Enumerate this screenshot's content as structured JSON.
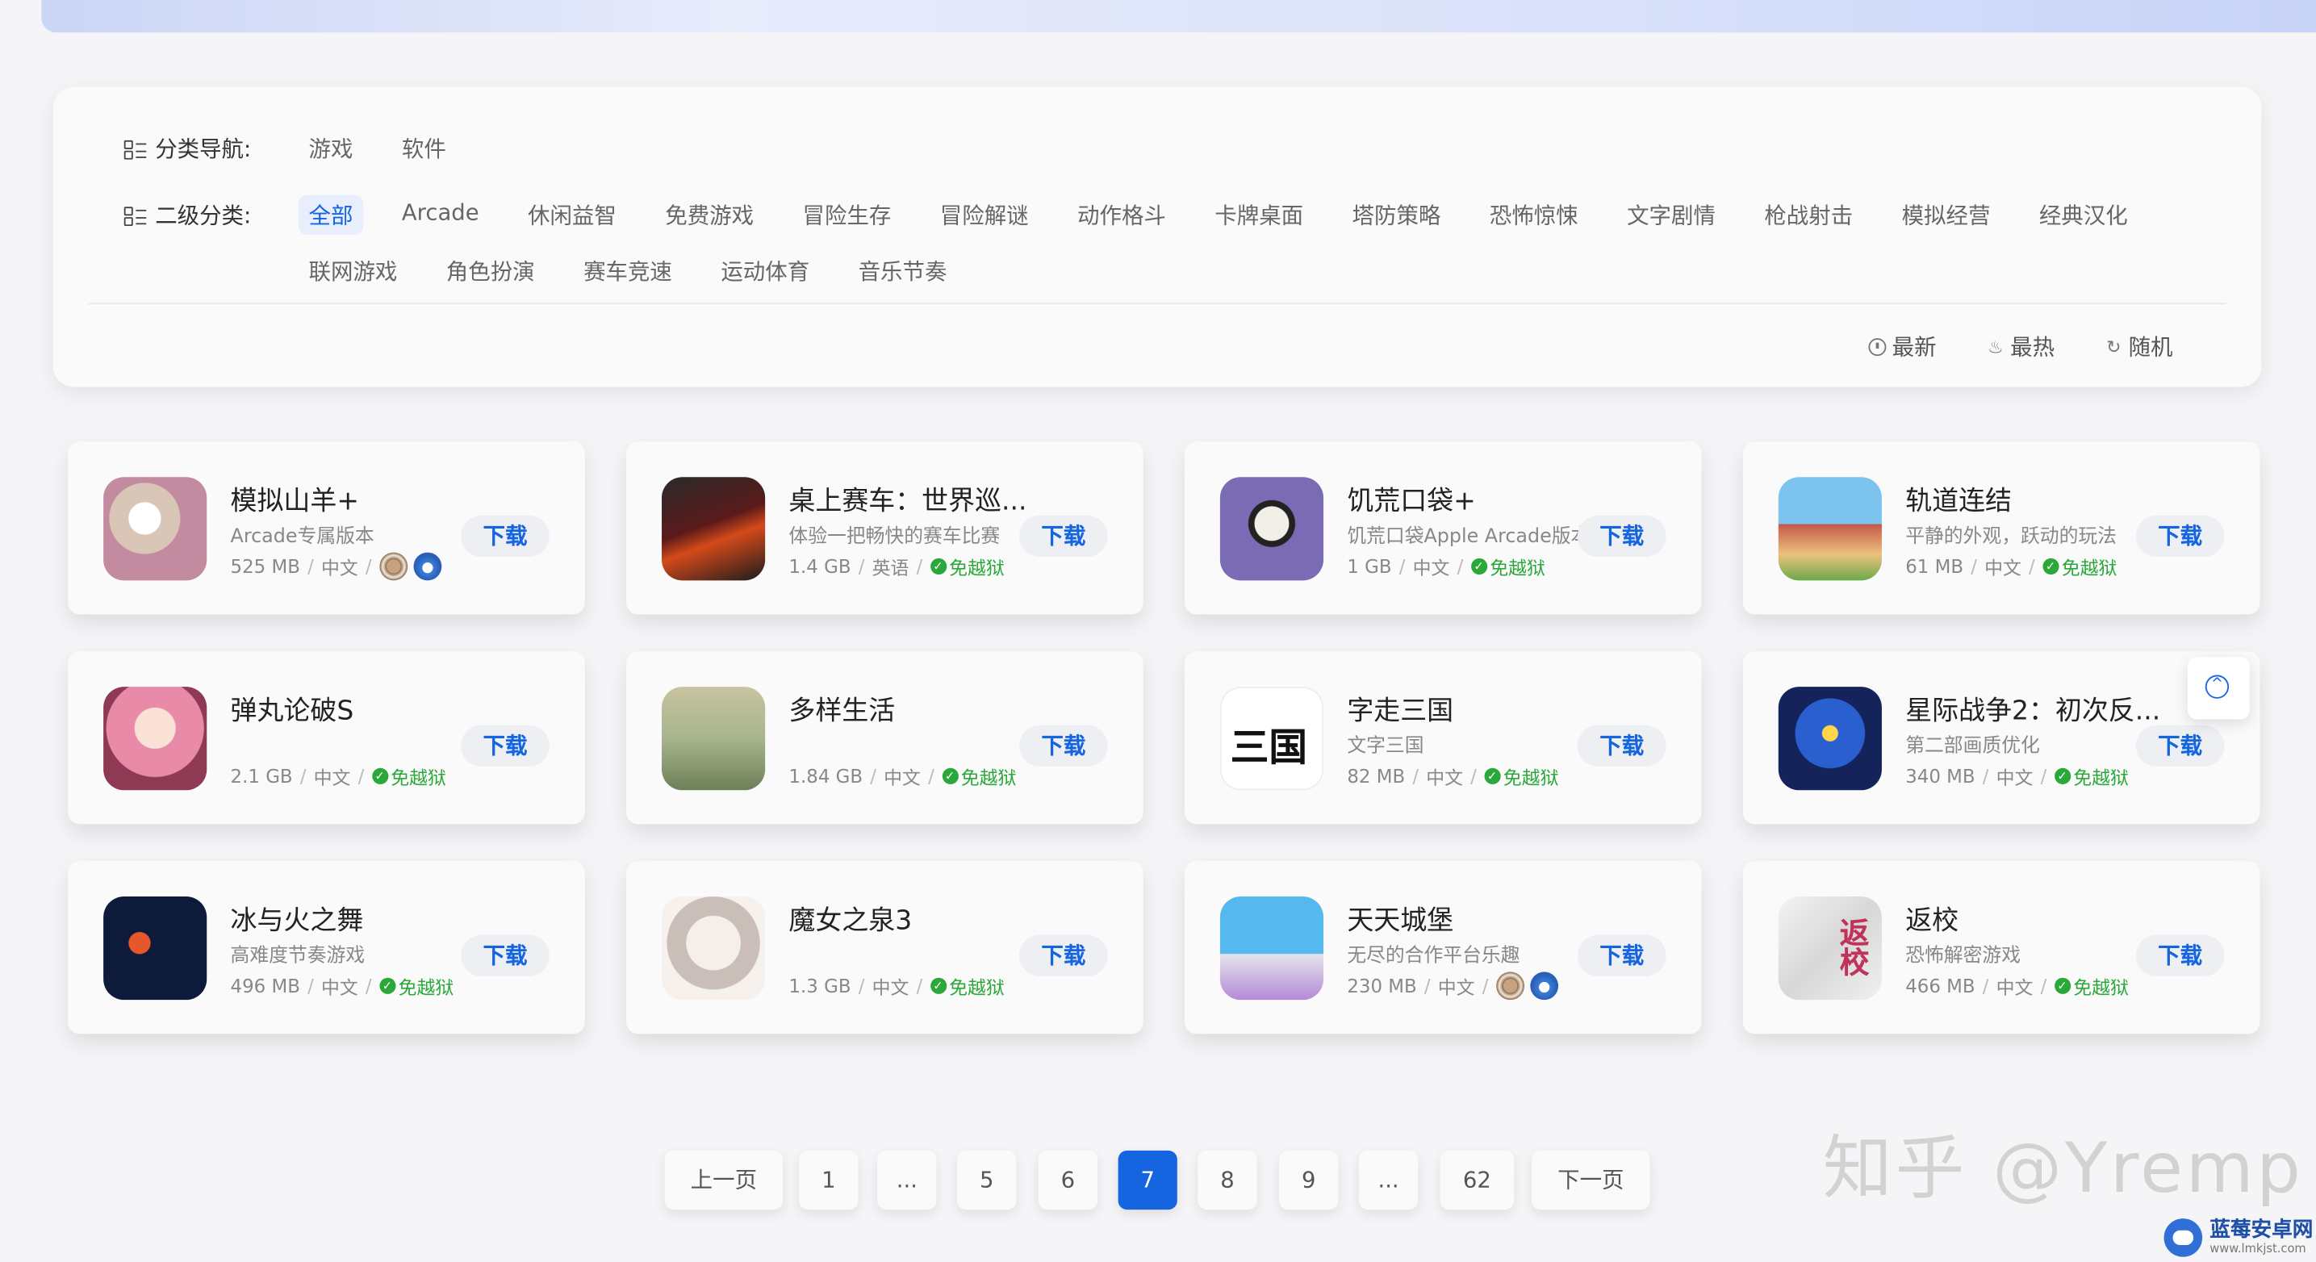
{
  "filters": {
    "category_label": "分类导航:",
    "categories": [
      "游戏",
      "软件"
    ],
    "subcategory_label": "二级分类:",
    "subcategories": [
      "全部",
      "Arcade",
      "休闲益智",
      "免费游戏",
      "冒险生存",
      "冒险解谜",
      "动作格斗",
      "卡牌桌面",
      "塔防策略",
      "恐怖惊悚",
      "文字剧情",
      "枪战射击",
      "模拟经营",
      "经典汉化",
      "联网游戏",
      "角色扮演",
      "赛车竞速",
      "运动体育",
      "音乐节奏"
    ],
    "active_subcategory": "全部",
    "sort": {
      "newest": "最新",
      "hottest": "最热",
      "random": "随机"
    }
  },
  "apps": [
    {
      "name": "模拟山羊+",
      "desc": "Arcade专属版本",
      "size": "525 MB",
      "lang": "中文",
      "jailbreak": "",
      "badges": true
    },
    {
      "name": "桌上赛车：世界巡...",
      "desc": "体验一把畅快的赛车比赛",
      "size": "1.4 GB",
      "lang": "英语",
      "jailbreak": "免越狱",
      "badges": false
    },
    {
      "name": "饥荒口袋+",
      "desc": "饥荒口袋Apple Arcade版本",
      "size": "1 GB",
      "lang": "中文",
      "jailbreak": "免越狱",
      "badges": false
    },
    {
      "name": "轨道连结",
      "desc": "平静的外观，跃动的玩法",
      "size": "61 MB",
      "lang": "中文",
      "jailbreak": "免越狱",
      "badges": false
    },
    {
      "name": "弹丸论破S",
      "desc": "",
      "size": "2.1 GB",
      "lang": "中文",
      "jailbreak": "免越狱",
      "badges": false
    },
    {
      "name": "多样生活",
      "desc": "",
      "size": "1.84 GB",
      "lang": "中文",
      "jailbreak": "免越狱",
      "badges": false
    },
    {
      "name": "字走三国",
      "desc": "文字三国",
      "size": "82 MB",
      "lang": "中文",
      "jailbreak": "免越狱",
      "badges": false
    },
    {
      "name": "星际战争2：初次反...",
      "desc": "第二部画质优化",
      "size": "340 MB",
      "lang": "中文",
      "jailbreak": "免越狱",
      "badges": false
    },
    {
      "name": "冰与火之舞",
      "desc": "高难度节奏游戏",
      "size": "496 MB",
      "lang": "中文",
      "jailbreak": "免越狱",
      "badges": false
    },
    {
      "name": "魔女之泉3",
      "desc": "",
      "size": "1.3 GB",
      "lang": "中文",
      "jailbreak": "免越狱",
      "badges": false
    },
    {
      "name": "天天城堡",
      "desc": "无尽的合作平台乐趣",
      "size": "230 MB",
      "lang": "中文",
      "jailbreak": "",
      "badges": true
    },
    {
      "name": "返校",
      "desc": "恐怖解密游戏",
      "size": "466 MB",
      "lang": "中文",
      "jailbreak": "免越狱",
      "badges": false
    }
  ],
  "download_label": "下载",
  "icon_text": {
    "sanguo": "三国",
    "fanxiao": "返校"
  },
  "pagination": {
    "prev": "上一页",
    "pages": [
      "1",
      "...",
      "5",
      "6",
      "7",
      "8",
      "9",
      "...",
      "62"
    ],
    "current": "7",
    "next": "下一页"
  },
  "watermark": "知乎 @Yremp",
  "corner_logo": {
    "title": "蓝莓安卓网",
    "url": "www.lmkjst.com"
  },
  "colors": {
    "accent": "#1565e0",
    "jailbreak": "#2aa83a"
  }
}
